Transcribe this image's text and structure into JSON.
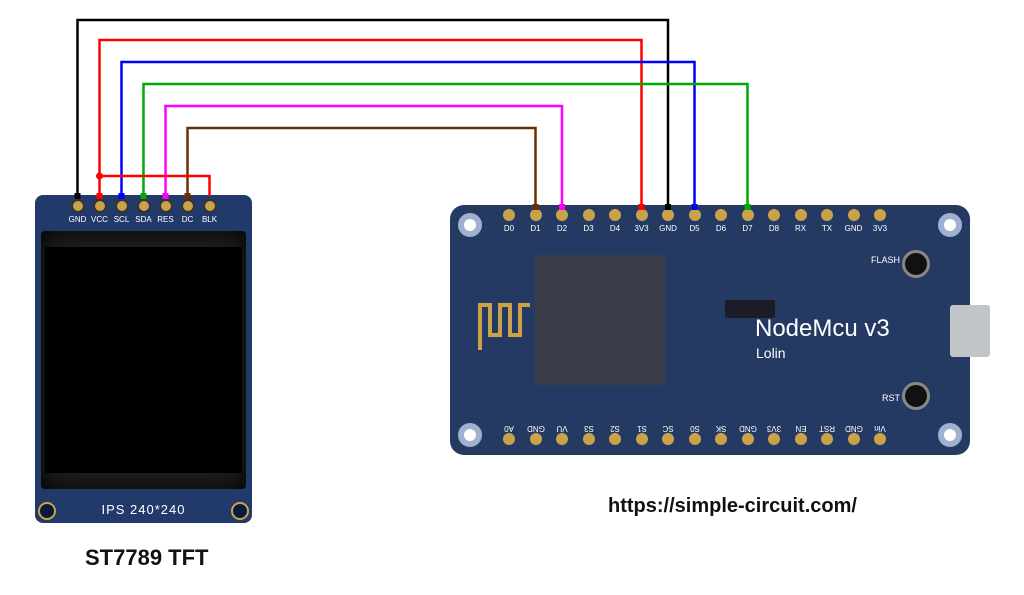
{
  "diagram": {
    "component_label": "ST7789 TFT",
    "source_url": "https://simple-circuit.com/",
    "tft": {
      "model_text": "IPS 240*240",
      "pins": [
        "GND",
        "VCC",
        "SCL",
        "SDA",
        "RES",
        "DC",
        "BLK"
      ]
    },
    "mcu": {
      "title": "NodeMcu v3",
      "subtitle": "Lolin",
      "buttons": {
        "flash": "FLASH",
        "rst": "RST"
      },
      "pins_top": [
        "D0",
        "D1",
        "D2",
        "D3",
        "D4",
        "3V3",
        "GND",
        "D5",
        "D6",
        "D7",
        "D8",
        "RX",
        "TX",
        "GND",
        "3V3"
      ],
      "pins_bottom": [
        "A0",
        "GND",
        "VU",
        "S3",
        "S2",
        "S1",
        "SC",
        "S0",
        "SK",
        "GND",
        "3V3",
        "EN",
        "RST",
        "GND",
        "Vin"
      ]
    },
    "wires": [
      {
        "name": "GND→GND",
        "color": "#000000",
        "tft_pin": "GND",
        "mcu_pin": "GND"
      },
      {
        "name": "VCC→3V3",
        "color": "#ff0000",
        "tft_pin": "VCC",
        "mcu_pin": "3V3"
      },
      {
        "name": "SCL→D5",
        "color": "#0000ff",
        "tft_pin": "SCL",
        "mcu_pin": "D5"
      },
      {
        "name": "SDA→D7",
        "color": "#00aa00",
        "tft_pin": "SDA",
        "mcu_pin": "D7"
      },
      {
        "name": "RES→D2",
        "color": "#ff00ff",
        "tft_pin": "RES",
        "mcu_pin": "D2"
      },
      {
        "name": "DC→D1",
        "color": "#6b2e00",
        "tft_pin": "DC",
        "mcu_pin": "D1"
      },
      {
        "name": "BLK→3V3",
        "color": "#ff0000",
        "tft_pin": "BLK",
        "mcu_pin": "3V3"
      }
    ]
  }
}
